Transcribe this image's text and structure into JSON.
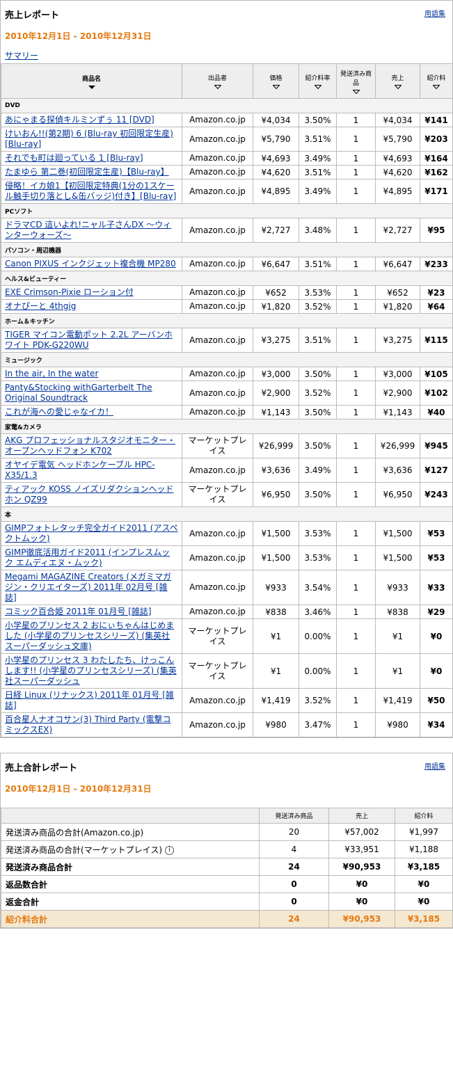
{
  "report": {
    "title": "売上レポート",
    "glossary": "用語集",
    "date_range": "2010年12月1日 - 2010年12月31日",
    "summary_link": "サマリー",
    "headers": {
      "name": "商品名",
      "seller": "出品者",
      "price": "価格",
      "rate": "紹介料率",
      "shipped": "発送済み商品",
      "sales": "売上",
      "fee": "紹介料"
    },
    "categories": [
      {
        "name": "DVD",
        "items": [
          {
            "name": "あにゃまる探偵キルミンずぅ 11 [DVD]",
            "seller": "Amazon.co.jp",
            "price": "¥4,034",
            "rate": "3.50%",
            "qty": "1",
            "sales": "¥4,034",
            "fee": "¥141"
          },
          {
            "name": "けいおん!!(第2期) 6 (Blu-ray 初回限定生産) [Blu-ray]",
            "seller": "Amazon.co.jp",
            "price": "¥5,790",
            "rate": "3.51%",
            "qty": "1",
            "sales": "¥5,790",
            "fee": "¥203"
          },
          {
            "name": "それでも町は廻っている 1 [Blu-ray]",
            "seller": "Amazon.co.jp",
            "price": "¥4,693",
            "rate": "3.49%",
            "qty": "1",
            "sales": "¥4,693",
            "fee": "¥164"
          },
          {
            "name": "たまゆら 第二巻(初回限定生産)【Blu-ray】",
            "seller": "Amazon.co.jp",
            "price": "¥4,620",
            "rate": "3.51%",
            "qty": "1",
            "sales": "¥4,620",
            "fee": "¥162"
          },
          {
            "name": "侵略！イカ娘1【初回限定特典(1分の1スケール触手切り落とし&缶バッジ)付き】[Blu-ray]",
            "seller": "Amazon.co.jp",
            "price": "¥4,895",
            "rate": "3.49%",
            "qty": "1",
            "sales": "¥4,895",
            "fee": "¥171"
          }
        ]
      },
      {
        "name": "PCソフト",
        "items": [
          {
            "name": "ドラマCD 這いよれ!ニャル子さんDX ～ウィンターウォーズ～",
            "seller": "Amazon.co.jp",
            "price": "¥2,727",
            "rate": "3.48%",
            "qty": "1",
            "sales": "¥2,727",
            "fee": "¥95"
          }
        ]
      },
      {
        "name": "パソコン・周辺機器",
        "items": [
          {
            "name": "Canon PIXUS インクジェット複合機 MP280",
            "seller": "Amazon.co.jp",
            "price": "¥6,647",
            "rate": "3.51%",
            "qty": "1",
            "sales": "¥6,647",
            "fee": "¥233"
          }
        ]
      },
      {
        "name": "ヘルス&ビューティー",
        "items": [
          {
            "name": "EXE Crimson-Pixie ローション付",
            "seller": "Amazon.co.jp",
            "price": "¥652",
            "rate": "3.53%",
            "qty": "1",
            "sales": "¥652",
            "fee": "¥23"
          },
          {
            "name": "オナぴーと 4thgig",
            "seller": "Amazon.co.jp",
            "price": "¥1,820",
            "rate": "3.52%",
            "qty": "1",
            "sales": "¥1,820",
            "fee": "¥64"
          }
        ]
      },
      {
        "name": "ホーム＆キッチン",
        "items": [
          {
            "name": "TIGER マイコン電動ポット 2.2L アーバンホワイト PDK-G220WU",
            "seller": "Amazon.co.jp",
            "price": "¥3,275",
            "rate": "3.51%",
            "qty": "1",
            "sales": "¥3,275",
            "fee": "¥115"
          }
        ]
      },
      {
        "name": "ミュージック",
        "items": [
          {
            "name": "In the air, In the water",
            "seller": "Amazon.co.jp",
            "price": "¥3,000",
            "rate": "3.50%",
            "qty": "1",
            "sales": "¥3,000",
            "fee": "¥105"
          },
          {
            "name": "Panty&Stocking withGarterbelt The Original Soundtrack",
            "seller": "Amazon.co.jp",
            "price": "¥2,900",
            "rate": "3.52%",
            "qty": "1",
            "sales": "¥2,900",
            "fee": "¥102"
          },
          {
            "name": "これが海への愛じゃなイカ！",
            "seller": "Amazon.co.jp",
            "price": "¥1,143",
            "rate": "3.50%",
            "qty": "1",
            "sales": "¥1,143",
            "fee": "¥40"
          }
        ]
      },
      {
        "name": "家電&カメラ",
        "items": [
          {
            "name": "AKG プロフェッショナルスタジオモニター・オープンヘッドフォン K702",
            "seller": "マーケットプレイス",
            "price": "¥26,999",
            "rate": "3.50%",
            "qty": "1",
            "sales": "¥26,999",
            "fee": "¥945"
          },
          {
            "name": "オヤイデ電気 ヘッドホンケーブル HPC-X35/1.3",
            "seller": "Amazon.co.jp",
            "price": "¥3,636",
            "rate": "3.49%",
            "qty": "1",
            "sales": "¥3,636",
            "fee": "¥127"
          },
          {
            "name": "ティアック KOSS ノイズリダクションヘッドホン QZ99",
            "seller": "マーケットプレイス",
            "price": "¥6,950",
            "rate": "3.50%",
            "qty": "1",
            "sales": "¥6,950",
            "fee": "¥243"
          }
        ]
      },
      {
        "name": "本",
        "items": [
          {
            "name": "GIMPフォトレタッチ完全ガイド2011 (アスペクトムック)",
            "seller": "Amazon.co.jp",
            "price": "¥1,500",
            "rate": "3.53%",
            "qty": "1",
            "sales": "¥1,500",
            "fee": "¥53"
          },
          {
            "name": "GIMP徹底活用ガイド2011 (インプレスムック エムディエヌ・ムック)",
            "seller": "Amazon.co.jp",
            "price": "¥1,500",
            "rate": "3.53%",
            "qty": "1",
            "sales": "¥1,500",
            "fee": "¥53"
          },
          {
            "name": "Megami MAGAZINE Creators (メガミマガジン・クリエイターズ) 2011年 02月号 [雑誌]",
            "seller": "Amazon.co.jp",
            "price": "¥933",
            "rate": "3.54%",
            "qty": "1",
            "sales": "¥933",
            "fee": "¥33"
          },
          {
            "name": "コミック百合姫 2011年 01月号 [雑誌]",
            "seller": "Amazon.co.jp",
            "price": "¥838",
            "rate": "3.46%",
            "qty": "1",
            "sales": "¥838",
            "fee": "¥29"
          },
          {
            "name": "小学星のプリンセス 2 おにぃちゃんはじめました (小学星のプリンセスシリーズ) (集英社スーパーダッシュ文庫)",
            "seller": "マーケットプレイス",
            "price": "¥1",
            "rate": "0.00%",
            "qty": "1",
            "sales": "¥1",
            "fee": "¥0"
          },
          {
            "name": "小学星のプリンセス 3 わたしたち、けっこんします!! (小学星のプリンセスシリーズ) (集英社スーパーダッシュ",
            "seller": "マーケットプレイス",
            "price": "¥1",
            "rate": "0.00%",
            "qty": "1",
            "sales": "¥1",
            "fee": "¥0"
          },
          {
            "name": "日経 Linux (リナックス) 2011年 01月号 [雑誌]",
            "seller": "Amazon.co.jp",
            "price": "¥1,419",
            "rate": "3.52%",
            "qty": "1",
            "sales": "¥1,419",
            "fee": "¥50"
          },
          {
            "name": "百合星人ナオコサン(3) Third Party (電撃コミックスEX)",
            "seller": "Amazon.co.jp",
            "price": "¥980",
            "rate": "3.47%",
            "qty": "1",
            "sales": "¥980",
            "fee": "¥34"
          }
        ]
      }
    ]
  },
  "totals": {
    "title": "売上合計レポート",
    "glossary": "用語集",
    "date_range": "2010年12月1日 - 2010年12月31日",
    "headers": {
      "shipped": "発送済み商品",
      "sales": "売上",
      "fee": "紹介料"
    },
    "rows": [
      {
        "label": "発送済み商品の合計(Amazon.co.jp)",
        "shipped": "20",
        "sales": "¥57,002",
        "fee": "¥1,997",
        "style": "normal"
      },
      {
        "label": "発送済み商品の合計(マーケットプレイス)",
        "shipped": "4",
        "sales": "¥33,951",
        "fee": "¥1,188",
        "style": "normal",
        "info": true
      },
      {
        "label": "発送済み商品合計",
        "shipped": "24",
        "sales": "¥90,953",
        "fee": "¥3,185",
        "style": "bold"
      },
      {
        "label": "返品数合計",
        "shipped": "0",
        "sales": "¥0",
        "fee": "¥0",
        "style": "bold"
      },
      {
        "label": "返金合計",
        "shipped": "0",
        "sales": "¥0",
        "fee": "¥0",
        "style": "bold"
      },
      {
        "label": "紹介料合計",
        "shipped": "24",
        "sales": "¥90,953",
        "fee": "¥3,185",
        "style": "fee"
      }
    ]
  }
}
